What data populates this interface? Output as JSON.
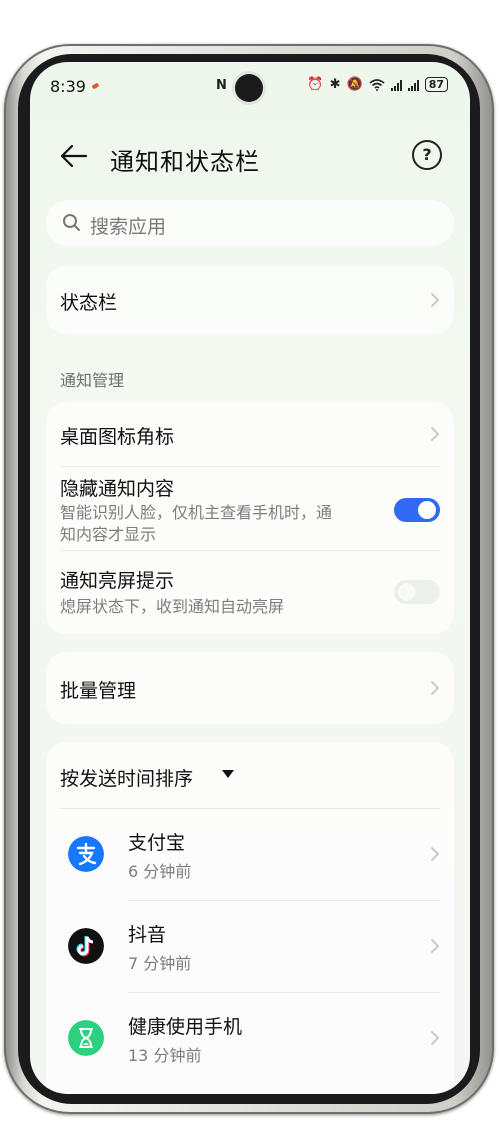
{
  "status_bar": {
    "time": "8:39",
    "battery": "87"
  },
  "header": {
    "title": "通知和状态栏",
    "help_symbol": "?"
  },
  "search": {
    "placeholder": "搜索应用"
  },
  "status_bar_entry": {
    "label": "状态栏"
  },
  "notification_management": {
    "section_label": "通知管理",
    "items": [
      {
        "label": "桌面图标角标"
      },
      {
        "label": "隐藏通知内容",
        "description_line1": "智能识别人脸，仅机主查看手机时，通",
        "description_line2": "知内容才显示",
        "toggle_on": true
      },
      {
        "label": "通知亮屏提示",
        "description_line1": "熄屏状态下，收到通知自动亮屏",
        "toggle_on": false
      }
    ]
  },
  "batch": {
    "label": "批量管理"
  },
  "apps": {
    "sort_label": "按发送时间排序",
    "items": [
      {
        "name": "支付宝",
        "time": "6 分钟前",
        "icon": "alipay-icon",
        "color": "#1677ff"
      },
      {
        "name": "抖音",
        "time": "7 分钟前",
        "icon": "douyin-icon",
        "color": "#111111"
      },
      {
        "name": "健康使用手机",
        "time": "13 分钟前",
        "icon": "hourglass-icon",
        "color": "#2bd17e"
      }
    ]
  },
  "colors": {
    "accent": "#2f6bf0",
    "background": "#f1f8ef"
  }
}
